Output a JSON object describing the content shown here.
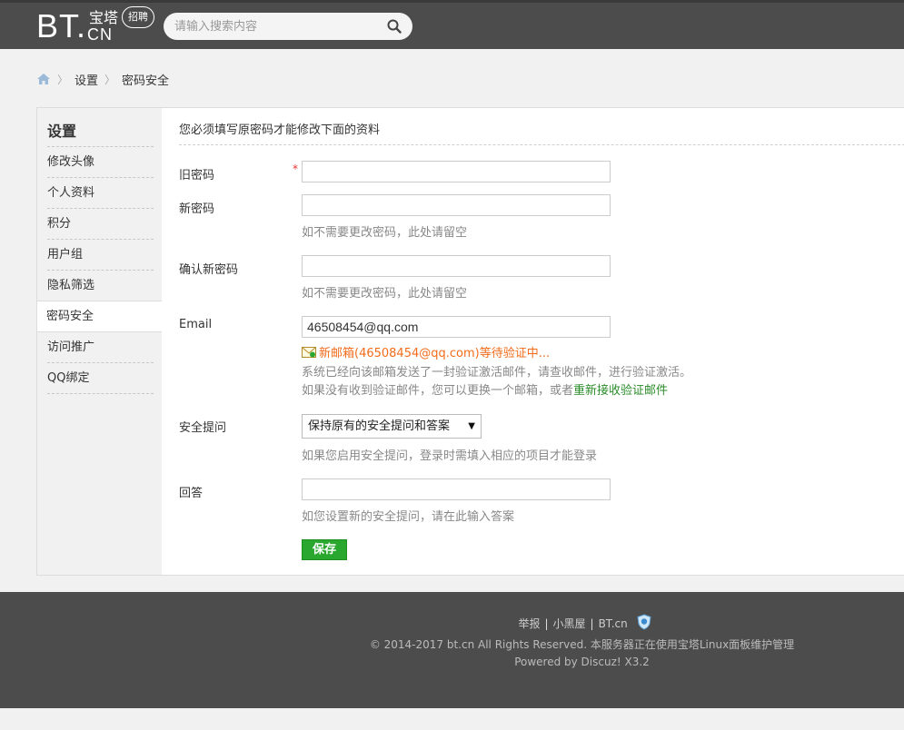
{
  "header": {
    "logo_bt": "BT.",
    "logo_cn_top": "宝塔",
    "logo_cn_bot": "CN",
    "logo_bubble": "招聘",
    "search_placeholder": "请输入搜索内容"
  },
  "breadcrumb": {
    "items": [
      "设置",
      "密码安全"
    ]
  },
  "sidebar": {
    "title": "设置",
    "items": [
      {
        "label": "修改头像"
      },
      {
        "label": "个人资料"
      },
      {
        "label": "积分"
      },
      {
        "label": "用户组"
      },
      {
        "label": "隐私筛选"
      },
      {
        "label": "密码安全",
        "active": true
      },
      {
        "label": "访问推广"
      },
      {
        "label": "QQ绑定"
      }
    ]
  },
  "form": {
    "notice": "您必须填写原密码才能修改下面的资料",
    "old_password_label": "旧密码",
    "required_mark": "*",
    "new_password_label": "新密码",
    "new_password_hint": "如不需要更改密码，此处请留空",
    "confirm_password_label": "确认新密码",
    "confirm_password_hint": "如不需要更改密码，此处请留空",
    "email_label": "Email",
    "email_value": "46508454@qq.com",
    "email_pending": "新邮箱(46508454@qq.com)等待验证中...",
    "email_sent_info": "系统已经向该邮箱发送了一封验证激活邮件，请查收邮件，进行验证激活。",
    "email_resend_prefix": "如果没有收到验证邮件，您可以更换一个邮箱，或者",
    "email_resend_link": "重新接收验证邮件",
    "security_question_label": "安全提问",
    "security_question_value": "保持原有的安全提问和答案",
    "security_question_hint": "如果您启用安全提问，登录时需填入相应的项目才能登录",
    "answer_label": "回答",
    "answer_hint": "如您设置新的安全提问，请在此输入答案",
    "save_label": "保存"
  },
  "footer": {
    "link_report": "举报",
    "link_blackroom": "小黑屋",
    "link_site": "BT.cn",
    "separator": "|",
    "copyright": "© 2014-2017 bt.cn All Rights Reserved.  本服务器正在使用宝塔Linux面板维护管理",
    "powered": "Powered by Discuz! X3.2"
  },
  "colors": {
    "header_bg": "#4c4c4c",
    "accent_green": "#2aa72e",
    "pending_orange": "#f26c1a",
    "link_green": "#2a8c2a"
  }
}
